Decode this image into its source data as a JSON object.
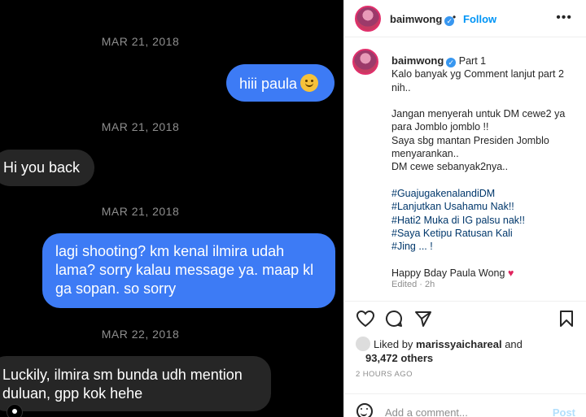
{
  "chat": {
    "timestamps": [
      "MAR 21, 2018",
      "MAR 21, 2018",
      "MAR 21, 2018",
      "MAR 22, 2018"
    ],
    "messages": [
      {
        "from": "me",
        "text": "hiii paula"
      },
      {
        "from": "them",
        "text": "Hi you back"
      },
      {
        "from": "me",
        "text": "lagi shooting? km kenal ilmira udah lama? sorry kalau message ya. maap kl ga sopan. so sorry"
      },
      {
        "from": "them",
        "text": "Luckily, ilmira sm bunda udh mention duluan, gpp kok hehe"
      }
    ]
  },
  "post": {
    "username": "baimwong",
    "follow_label": "Follow",
    "more_icon": "more-options-icon",
    "caption_lines": [
      "Part 1",
      "Kalo banyak yg Comment lanjut part 2 nih..",
      "",
      "Jangan menyerah untuk DM cewe2 ya para Jomblo jomblo !!",
      "Saya sbg mantan Presiden Jomblo menyarankan..",
      "DM cewe sebanyak2nya..",
      "",
      "#GuajugakenalandiDM",
      "#Lanjutkan Usahamu Nak!!",
      "#Hati2 Muka di IG palsu nak!!",
      "#Saya Ketipu Ratusan Kali",
      "#Jing ... !",
      "",
      "Happy Bday Paula Wong"
    ],
    "edited": "Edited · 2h",
    "likes_prefix": "Liked by",
    "liked_by_user": "marissyaichareal",
    "likes_and": "and",
    "likes_count": "93,472 others",
    "time_ago": "2 HOURS AGO",
    "comment_placeholder": "Add a comment...",
    "post_label": "Post",
    "colors": {
      "accent": "#0095f6",
      "bubble_out": "#3d7bf5",
      "bubble_in": "#262626"
    }
  }
}
